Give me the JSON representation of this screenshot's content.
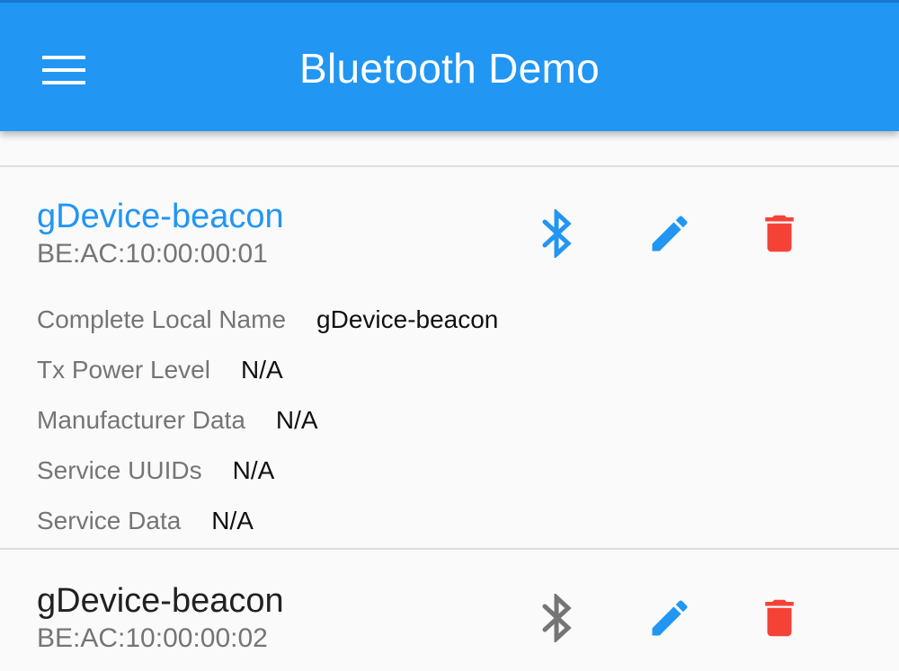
{
  "app_bar": {
    "title": "Bluetooth Demo",
    "menu_icon": "menu-icon",
    "color": "#2196f3"
  },
  "devices": [
    {
      "name": "gDevice-beacon",
      "mac": "BE:AC:10:00:00:01",
      "selected": true,
      "bluetooth_icon": "bluetooth-icon",
      "edit_icon": "edit-icon",
      "delete_icon": "delete-icon",
      "details": [
        {
          "label": "Complete Local Name",
          "value": "gDevice-beacon"
        },
        {
          "label": "Tx Power Level",
          "value": "N/A"
        },
        {
          "label": "Manufacturer Data",
          "value": "N/A"
        },
        {
          "label": "Service UUIDs",
          "value": "N/A"
        },
        {
          "label": "Service Data",
          "value": "N/A"
        }
      ]
    },
    {
      "name": "gDevice-beacon",
      "mac": "BE:AC:10:00:00:02",
      "selected": false,
      "bluetooth_icon": "bluetooth-icon",
      "edit_icon": "edit-icon",
      "delete_icon": "delete-icon"
    }
  ],
  "colors": {
    "accent": "#2196f3",
    "delete": "#f44336",
    "inactive_icon": "#757575"
  }
}
